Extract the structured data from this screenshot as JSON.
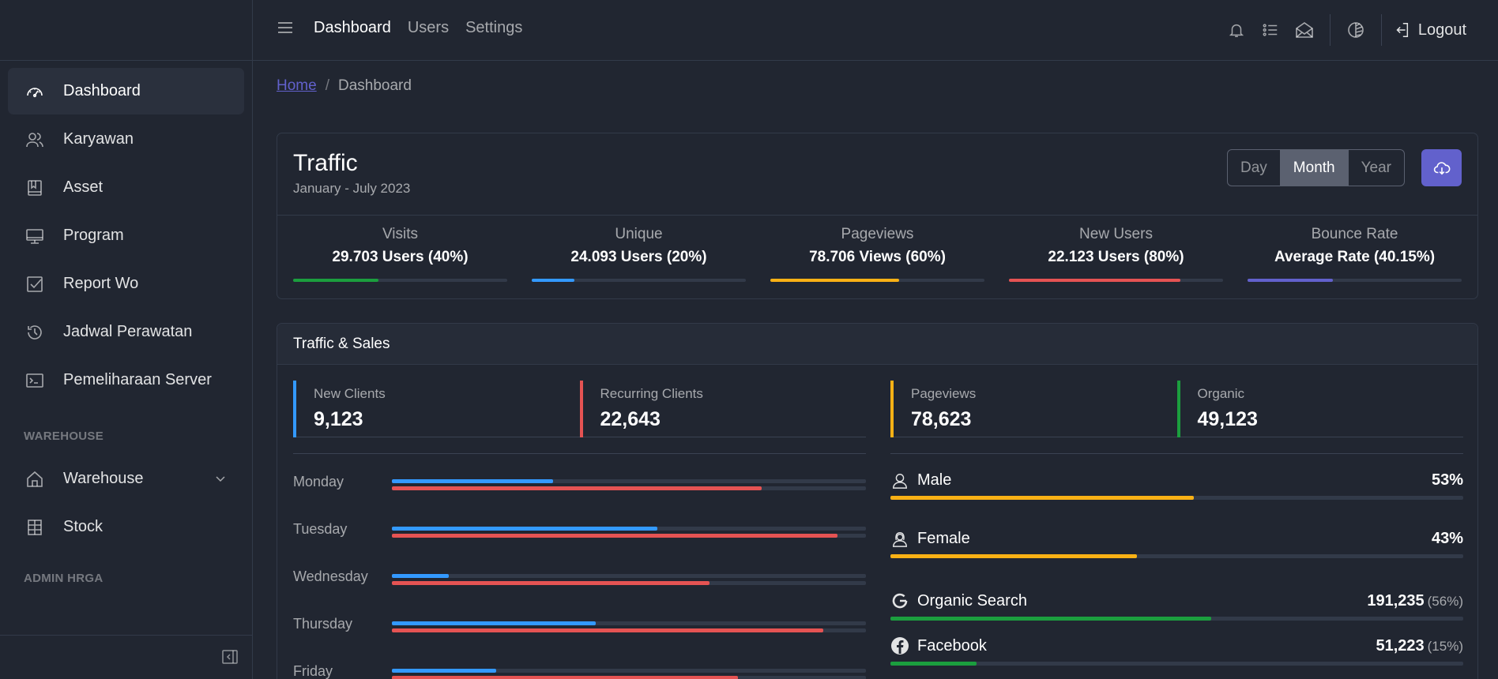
{
  "sidebar": {
    "items": [
      {
        "label": "Dashboard",
        "icon": "speedometer-icon"
      },
      {
        "label": "Karyawan",
        "icon": "people-icon"
      },
      {
        "label": "Asset",
        "icon": "book-icon"
      },
      {
        "label": "Program",
        "icon": "monitor-icon"
      },
      {
        "label": "Report Wo",
        "icon": "check-square-icon"
      },
      {
        "label": "Jadwal Perawatan",
        "icon": "history-icon"
      },
      {
        "label": "Pemeliharaan Server",
        "icon": "terminal-icon"
      }
    ],
    "section_warehouse": "WAREHOUSE",
    "warehouse_items": [
      {
        "label": "Warehouse",
        "icon": "home-icon"
      },
      {
        "label": "Stock",
        "icon": "building-icon"
      }
    ],
    "section_admin": "ADMIN HRGA"
  },
  "header": {
    "nav": [
      "Dashboard",
      "Users",
      "Settings"
    ],
    "logout": "Logout"
  },
  "breadcrumb": {
    "home": "Home",
    "separator": "/",
    "current": "Dashboard"
  },
  "traffic": {
    "title": "Traffic",
    "subtitle": "January - July 2023",
    "range_buttons": [
      "Day",
      "Month",
      "Year"
    ],
    "active_range": "Month",
    "stats": [
      {
        "label": "Visits",
        "value": "29.703 Users (40%)",
        "percent": 40,
        "color": "#1b9e3e"
      },
      {
        "label": "Unique",
        "value": "24.093 Users (20%)",
        "percent": 20,
        "color": "#3399ff"
      },
      {
        "label": "Pageviews",
        "value": "78.706 Views (60%)",
        "percent": 60,
        "color": "#f9b115"
      },
      {
        "label": "New Users",
        "value": "22.123 Users (80%)",
        "percent": 80,
        "color": "#e55353"
      },
      {
        "label": "Bounce Rate",
        "value": "Average Rate (40.15%)",
        "percent": 40,
        "color": "#6261cc"
      }
    ]
  },
  "sales": {
    "title": "Traffic & Sales",
    "callouts_left": [
      {
        "label": "New Clients",
        "value": "9,123",
        "color": "#3399ff"
      },
      {
        "label": "Recurring Clients",
        "value": "22,643",
        "color": "#e55353"
      }
    ],
    "callouts_right": [
      {
        "label": "Pageviews",
        "value": "78,623",
        "color": "#f9b115"
      },
      {
        "label": "Organic",
        "value": "49,123",
        "color": "#1b9e3e"
      }
    ],
    "days": [
      {
        "label": "Monday",
        "blue": 34,
        "red": 78
      },
      {
        "label": "Tuesday",
        "blue": 56,
        "red": 94
      },
      {
        "label": "Wednesday",
        "blue": 12,
        "red": 67
      },
      {
        "label": "Thursday",
        "blue": 43,
        "red": 91
      },
      {
        "label": "Friday",
        "blue": 22,
        "red": 73
      }
    ],
    "gender": [
      {
        "label": "Male",
        "value": "53%",
        "percent": 53,
        "icon": "user-icon"
      },
      {
        "label": "Female",
        "value": "43%",
        "percent": 43,
        "icon": "user-female-icon"
      }
    ],
    "sources": [
      {
        "label": "Organic Search",
        "value": "191,235",
        "pct": "(56%)",
        "percent": 56,
        "color": "#1b9e3e",
        "icon": "google-icon"
      },
      {
        "label": "Facebook",
        "value": "51,223",
        "pct": "(15%)",
        "percent": 15,
        "color": "#1b9e3e",
        "icon": "facebook-icon"
      }
    ]
  },
  "colors": {
    "blue": "#3399ff",
    "red": "#e55353",
    "yellow": "#f9b115",
    "primary": "#6261cc"
  }
}
